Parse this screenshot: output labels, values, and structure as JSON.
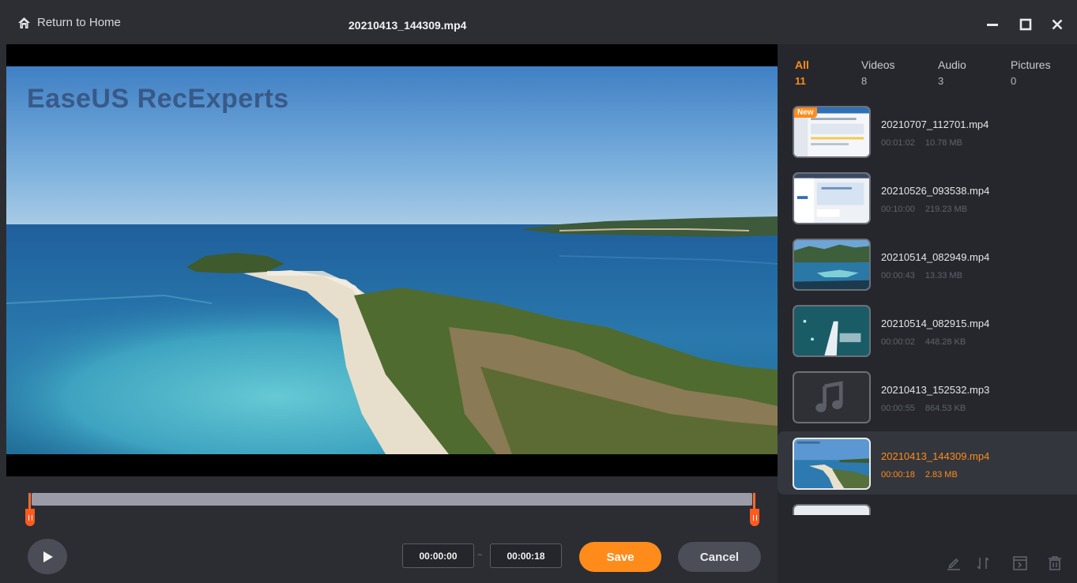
{
  "window": {
    "return_home_label": "Return to Home",
    "title": "20210413_144309.mp4"
  },
  "preview": {
    "watermark": "EaseUS RecExperts"
  },
  "trim": {
    "start_time": "00:00:00",
    "separator": "~",
    "end_time": "00:00:18",
    "save_label": "Save",
    "cancel_label": "Cancel"
  },
  "tabs": [
    {
      "label": "All",
      "count": "11",
      "active": true
    },
    {
      "label": "Videos",
      "count": "8"
    },
    {
      "label": "Audio",
      "count": "3"
    },
    {
      "label": "Pictures",
      "count": "0"
    }
  ],
  "files": [
    {
      "name": "20210707_112701.mp4",
      "duration": "00:01:02",
      "size": "10.78 MB",
      "badge": "New",
      "thumb": "screenshot"
    },
    {
      "name": "20210526_093538.mp4",
      "duration": "00:10:00",
      "size": "219.23 MB",
      "thumb": "screenshot"
    },
    {
      "name": "20210514_082949.mp4",
      "duration": "00:00:43",
      "size": "13.33 MB",
      "thumb": "landscape"
    },
    {
      "name": "20210514_082915.mp4",
      "duration": "00:00:02",
      "size": "448.28 KB",
      "thumb": "ocean"
    },
    {
      "name": "20210413_152532.mp3",
      "duration": "00:00:55",
      "size": "864.53 KB",
      "thumb": "music-icon"
    },
    {
      "name": "20210413_144309.mp4",
      "duration": "00:00:18",
      "size": "2.83 MB",
      "thumb": "beach",
      "selected": true
    }
  ],
  "colors": {
    "accent": "#ff8c1a",
    "trim_handle": "#ff5a1f",
    "panel_bg": "#25272c",
    "window_bg": "#2b2d33"
  },
  "icons": {
    "titlebar": [
      "home-icon",
      "minimize-icon",
      "maximize-icon",
      "close-icon"
    ],
    "player": [
      "play-icon"
    ],
    "toolbar": [
      "edit-icon",
      "sort-icon",
      "export-icon",
      "delete-icon"
    ]
  }
}
